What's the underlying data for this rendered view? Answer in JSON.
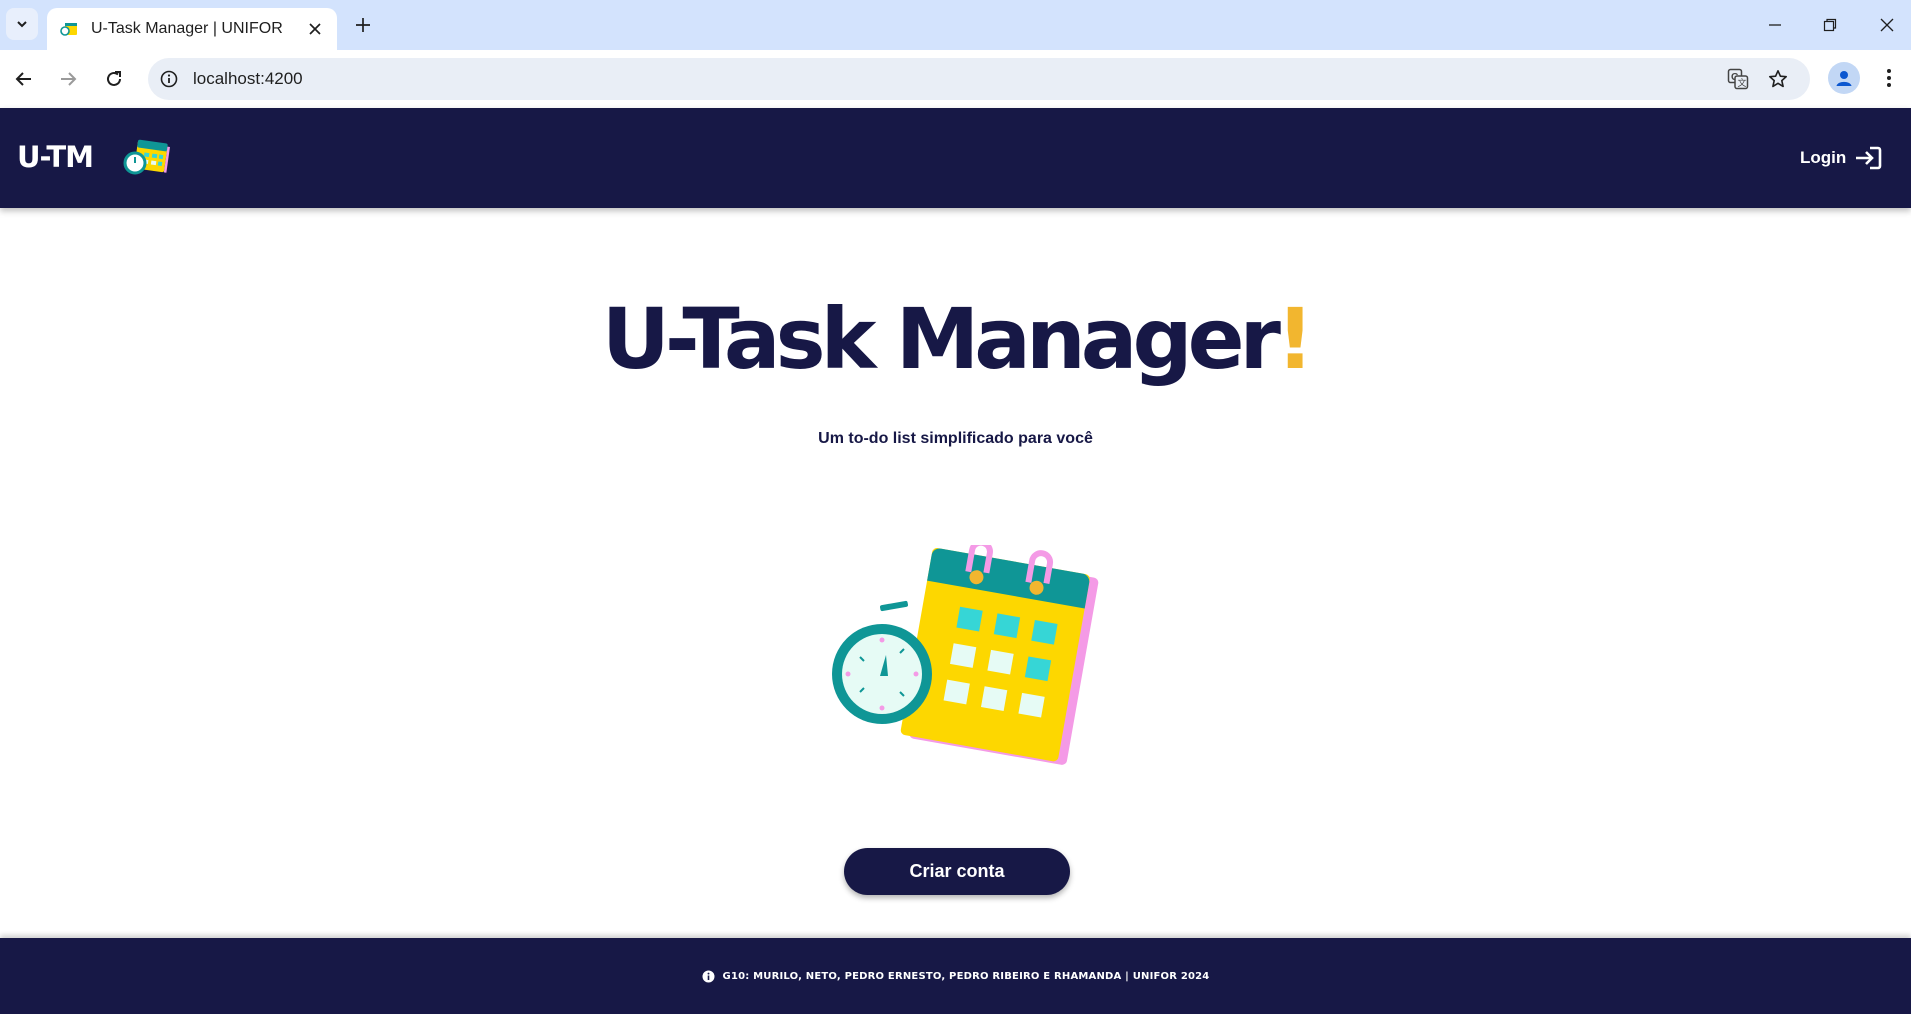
{
  "browser": {
    "tab_title": "U-Task Manager | UNIFOR",
    "url": "localhost:4200",
    "icons": [
      "tab-search-icon",
      "close-icon",
      "plus-icon",
      "minimize-icon",
      "restore-icon",
      "window-close-icon",
      "back-icon",
      "forward-icon",
      "reload-icon",
      "site-info-icon",
      "translate-icon",
      "bookmark-star-icon",
      "profile-icon",
      "more-menu-icon"
    ]
  },
  "header": {
    "brand": "U-TM",
    "login_label": "Login"
  },
  "hero": {
    "title": "U-Task Manager",
    "title_accent": "!",
    "subtitle": "Um to-do list simplificado para você"
  },
  "actions": {
    "create_account_label": "Criar conta"
  },
  "footer": {
    "credits": "G10: MURILO, NETO, PEDRO ERNESTO, PEDRO RIBEIRO E RHAMANDA |  UNIFOR 2024"
  },
  "colors": {
    "navy": "#171846",
    "accent_yellow": "#f2b62f",
    "calendar_yellow": "#fdd700",
    "teal": "#0f9696",
    "pink": "#f49ae6"
  }
}
